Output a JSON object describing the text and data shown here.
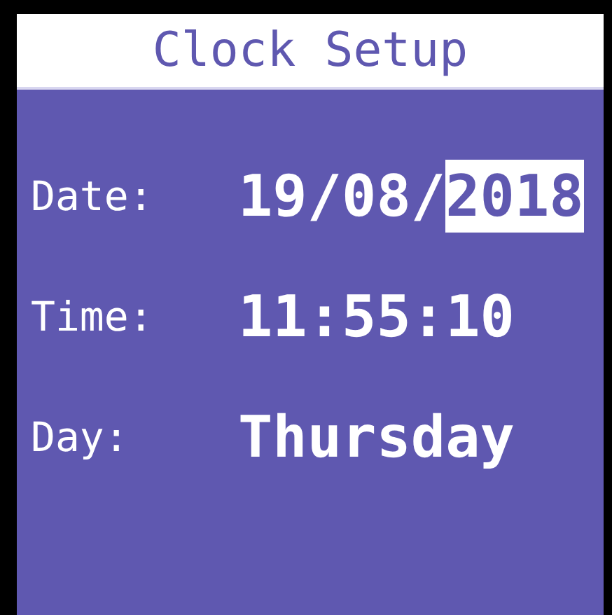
{
  "title": "Clock Setup",
  "rows": [
    {
      "label": "Date:",
      "segments": [
        {
          "text": "19/08/",
          "selected": false
        },
        {
          "text": "2018",
          "selected": true
        }
      ]
    },
    {
      "label": "Time:",
      "segments": [
        {
          "text": "11:55:10",
          "selected": false
        }
      ]
    },
    {
      "label": "Day:",
      "segments": [
        {
          "text": "Thursday",
          "selected": false
        }
      ]
    }
  ]
}
